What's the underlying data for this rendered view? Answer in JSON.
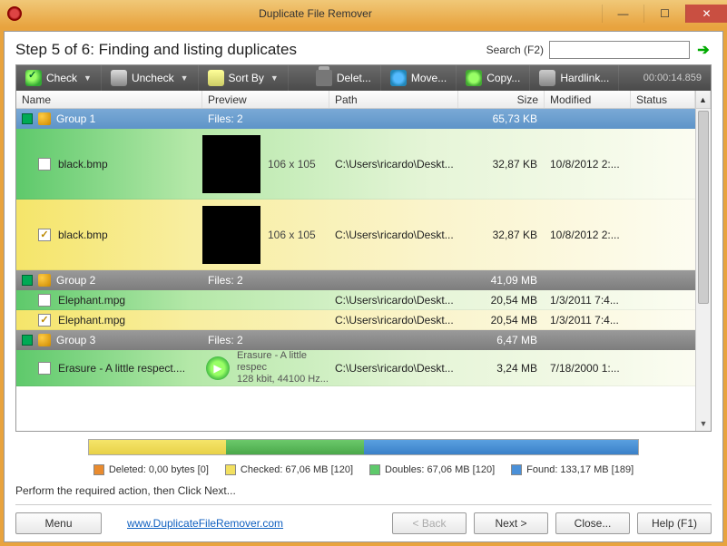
{
  "window": {
    "title": "Duplicate File Remover"
  },
  "step": "Step 5 of 6: Finding and listing duplicates",
  "search": {
    "label": "Search (F2)",
    "value": ""
  },
  "toolbar": {
    "check": "Check",
    "uncheck": "Uncheck",
    "sort": "Sort By",
    "delete": "Delet...",
    "move": "Move...",
    "copy": "Copy...",
    "hardlink": "Hardlink...",
    "timer": "00:00:14.859"
  },
  "columns": {
    "name": "Name",
    "preview": "Preview",
    "path": "Path",
    "size": "Size",
    "modified": "Modified",
    "status": "Status"
  },
  "groups": [
    {
      "name": "Group 1",
      "files_label": "Files: 2",
      "size": "65,73 KB"
    },
    {
      "name": "Group 2",
      "files_label": "Files: 2",
      "size": "41,09 MB"
    },
    {
      "name": "Group 3",
      "files_label": "Files: 2",
      "size": "6,47 MB"
    }
  ],
  "rows": {
    "g1a": {
      "name": "black.bmp",
      "dims": "106 x 105",
      "path": "C:\\Users\\ricardo\\Deskt...",
      "size": "32,87 KB",
      "mod": "10/8/2012 2:...",
      "checked": false
    },
    "g1b": {
      "name": "black.bmp",
      "dims": "106 x 105",
      "path": "C:\\Users\\ricardo\\Deskt...",
      "size": "32,87 KB",
      "mod": "10/8/2012 2:...",
      "checked": true
    },
    "g2a": {
      "name": "Elephant.mpg",
      "path": "C:\\Users\\ricardo\\Deskt...",
      "size": "20,54 MB",
      "mod": "1/3/2011 7:4...",
      "checked": false
    },
    "g2b": {
      "name": "Elephant.mpg",
      "path": "C:\\Users\\ricardo\\Deskt...",
      "size": "20,54 MB",
      "mod": "1/3/2011 7:4...",
      "checked": true
    },
    "g3a": {
      "name": "Erasure - A little respect....",
      "music1": "Erasure - A little respec",
      "music2": "128 kbit, 44100 Hz...",
      "path": "C:\\Users\\ricardo\\Deskt...",
      "size": "3,24 MB",
      "mod": "7/18/2000 1:...",
      "checked": false
    }
  },
  "legend": {
    "deleted": "Deleted: 0,00 bytes [0]",
    "checked": "Checked: 67,06 MB [120]",
    "doubles": "Doubles: 67,06 MB [120]",
    "found": "Found: 133,17 MB [189]"
  },
  "hint": "Perform the required action, then Click Next...",
  "buttons": {
    "menu": "Menu",
    "link": "www.DuplicateFileRemover.com",
    "back": "< Back",
    "next": "Next >",
    "close": "Close...",
    "help": "Help (F1)"
  }
}
